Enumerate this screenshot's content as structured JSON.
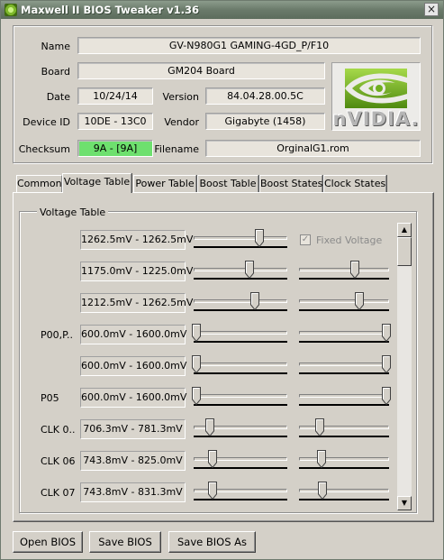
{
  "window": {
    "title": "Maxwell II BIOS Tweaker v1.36",
    "close_glyph": "×"
  },
  "info": {
    "name_label": "Name",
    "name": "GV-N980G1 GAMING-4GD_P/F10",
    "board_label": "Board",
    "board": "GM204 Board",
    "date_label": "Date",
    "date": "10/24/14",
    "version_label": "Version",
    "version": "84.04.28.00.5C",
    "device_id_label": "Device ID",
    "device_id": "10DE - 13C0",
    "vendor_label": "Vendor",
    "vendor": "Gigabyte (1458)",
    "checksum_label": "Checksum",
    "checksum": "9A - [9A]",
    "filename_label": "Filename",
    "filename": "OrginalG1.rom",
    "checksum_color": "#6ee06e",
    "logo_text": "nVIDIA."
  },
  "tabs": [
    {
      "label": "Common",
      "active": false
    },
    {
      "label": "Voltage Table",
      "active": true
    },
    {
      "label": "Power Table",
      "active": false
    },
    {
      "label": "Boost Table",
      "active": false
    },
    {
      "label": "Boost States",
      "active": false
    },
    {
      "label": "Clock States",
      "active": false
    }
  ],
  "voltage_table": {
    "title": "Voltage Table",
    "fixed_voltage": {
      "label": "Fixed Voltage",
      "checked": true,
      "enabled": false
    },
    "rows": [
      {
        "label": "",
        "range": "1262.5mV - 1262.5mV",
        "slider1": 0.7,
        "slider2": null
      },
      {
        "label": "",
        "range": "1175.0mV - 1225.0mV",
        "slider1": 0.6,
        "slider2": 0.62
      },
      {
        "label": "",
        "range": "1212.5mV - 1262.5mV",
        "slider1": 0.65,
        "slider2": 0.67
      },
      {
        "label": "P00,P..",
        "range": "600.0mV - 1600.0mV",
        "slider1": 0.03,
        "slider2": 0.97
      },
      {
        "label": "",
        "range": "600.0mV - 1600.0mV",
        "slider1": 0.03,
        "slider2": 0.97
      },
      {
        "label": "P05",
        "range": "600.0mV - 1600.0mV",
        "slider1": 0.03,
        "slider2": 0.97
      },
      {
        "label": "CLK 0..",
        "range": "706.3mV - 781.3mV",
        "slider1": 0.17,
        "slider2": 0.23
      },
      {
        "label": "CLK 06",
        "range": "743.8mV - 825.0mV",
        "slider1": 0.2,
        "slider2": 0.25
      },
      {
        "label": "CLK 07",
        "range": "743.8mV - 831.3mV",
        "slider1": 0.2,
        "slider2": 0.26
      }
    ]
  },
  "scrollbar": {
    "up_glyph": "▲",
    "down_glyph": "▼"
  },
  "buttons": {
    "open": "Open BIOS",
    "save": "Save BIOS",
    "save_as": "Save BIOS As"
  }
}
